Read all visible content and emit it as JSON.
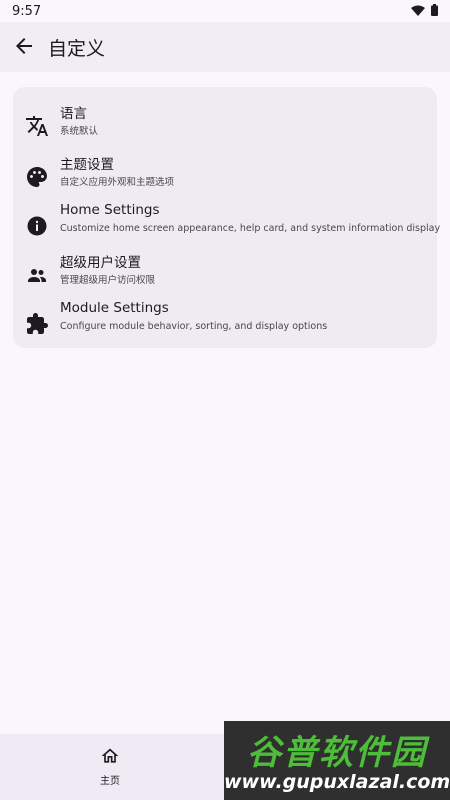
{
  "status": {
    "time": "9:57"
  },
  "header": {
    "title": "自定义"
  },
  "settings": [
    {
      "title": "语言",
      "subtitle": "系统默认",
      "icon": "translate-icon"
    },
    {
      "title": "主题设置",
      "subtitle": "自定义应用外观和主题选项",
      "icon": "palette-icon"
    },
    {
      "title": "Home Settings",
      "subtitle": "Customize home screen appearance, help card, and system information display",
      "icon": "info-icon"
    },
    {
      "title": "超级用户设置",
      "subtitle": "管理超级用户访问权限",
      "icon": "people-icon"
    },
    {
      "title": "Module Settings",
      "subtitle": "Configure module behavior, sorting, and display options",
      "icon": "puzzle-icon"
    }
  ],
  "bottom_nav": {
    "home_label": "主页"
  },
  "watermark": {
    "brand": "谷普软件园",
    "url": "www.gupuxlazal.com"
  }
}
